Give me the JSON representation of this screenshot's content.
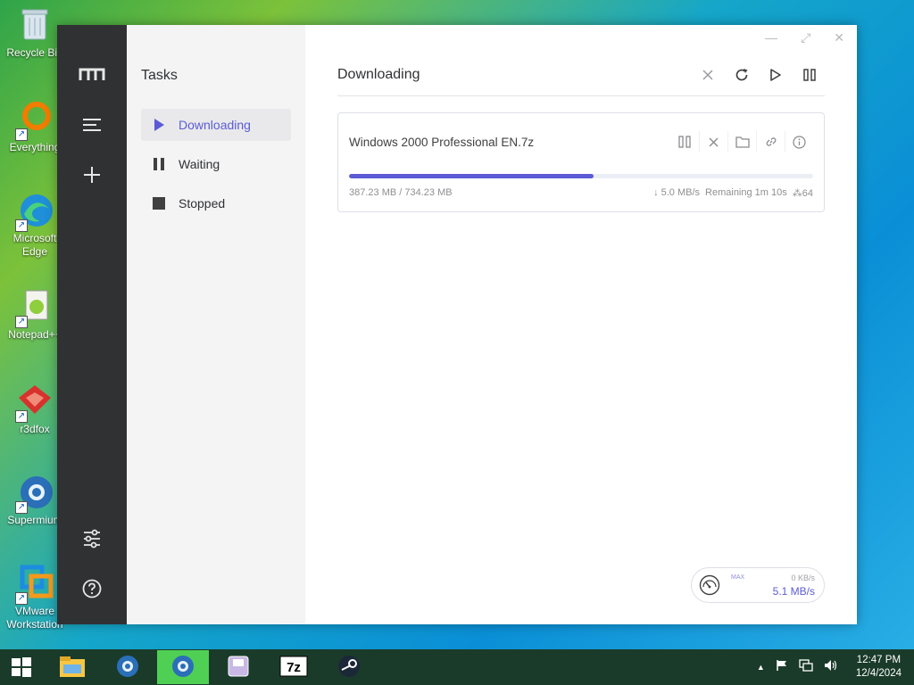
{
  "desktop": {
    "icons": [
      {
        "label": "Recycle Bin"
      },
      {
        "label": "Everything"
      },
      {
        "label": "Microsoft Edge"
      },
      {
        "label": "Notepad++"
      },
      {
        "label": "r3dfox"
      },
      {
        "label": "Supermium"
      },
      {
        "label": "VMware Workstation"
      }
    ]
  },
  "app": {
    "window_controls": {
      "minimize": "—",
      "maximize": "⤢",
      "close": "✕"
    },
    "nav": {
      "title": "Tasks",
      "items": [
        {
          "label": "Downloading",
          "icon": "play-icon",
          "active": true
        },
        {
          "label": "Waiting",
          "icon": "pause-icon",
          "active": false
        },
        {
          "label": "Stopped",
          "icon": "stop-icon",
          "active": false
        }
      ]
    },
    "main": {
      "title": "Downloading",
      "task": {
        "name": "Windows 2000 Professional EN.7z",
        "progress_fraction": 0.527,
        "size_text": "387.23 MB / 734.23 MB",
        "speed_text": "↓ 5.0 MB/s",
        "remaining_text": "Remaining 1m 10s",
        "connections_text": "64"
      },
      "speed_widget": {
        "max_label": "MAX",
        "upload": "0 KB/s",
        "download": "5.1 MB/s"
      }
    }
  },
  "taskbar": {
    "time": "12:47 PM",
    "date": "12/4/2024",
    "apps": [
      "file-explorer",
      "supermium",
      "supermium-active",
      "cdburner",
      "7zip",
      "steam"
    ]
  },
  "colors": {
    "accent": "#5b5bd6",
    "rail": "#303133",
    "nav_bg": "#f4f4f5"
  }
}
